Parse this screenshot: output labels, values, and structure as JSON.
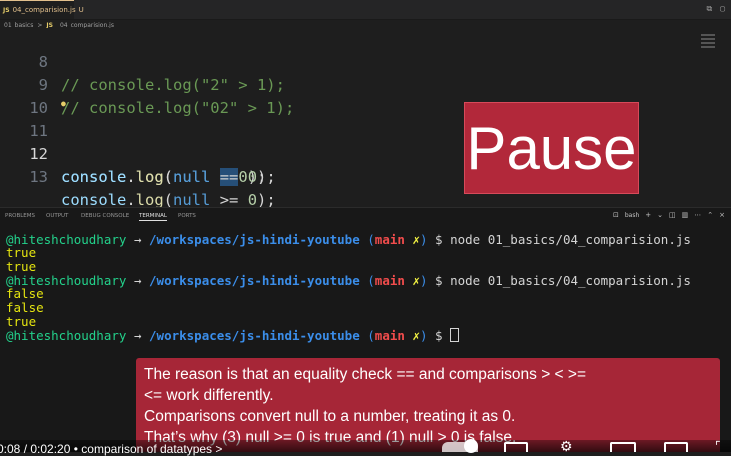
{
  "tab": {
    "name": "04_comparision.js",
    "badge": "JS",
    "modified": "U"
  },
  "breadcrumb": {
    "folder": "01_basics",
    "sep": ">",
    "file": "04_comparision.js"
  },
  "editor": {
    "lines": [
      {
        "num": "8",
        "text": "// console.log(\"2\" > 1);"
      },
      {
        "num": "9",
        "text": "// console.log(\"02\" > 1);"
      },
      {
        "num": "10",
        "text": ""
      },
      {
        "num": "11",
        "obj": "console",
        "fn": "log",
        "kw": "null",
        "op": ">",
        "val": "0"
      },
      {
        "num": "12",
        "obj": "console",
        "fn": "log",
        "kw": "null",
        "op": "==",
        "val": "0"
      },
      {
        "num": "13",
        "obj": "console",
        "fn": "log",
        "kw": "null",
        "op": ">=",
        "val": "0"
      }
    ]
  },
  "pause_overlay": "Pause",
  "panel": {
    "tabs": [
      "PROBLEMS",
      "OUTPUT",
      "DEBUG CONSOLE",
      "TERMINAL",
      "PORTS"
    ],
    "shell": "bash",
    "add": "+"
  },
  "terminal": {
    "user": "@hiteshchoudhary",
    "arrow": "→",
    "path": "/workspaces/js-hindi-youtube",
    "git_open": "(",
    "branch": "main",
    "dirty": "✗",
    "git_close": ")",
    "prompt": "$",
    "command": "node 01_basics/04_comparision.js",
    "outputs1": [
      "true",
      "true"
    ],
    "outputs2": [
      "false",
      "false",
      "true"
    ]
  },
  "caption": [
    "The reason is that an equality check == and comparisons > < >=",
    "<= work differently.",
    "Comparisons convert null to a number, treating it as 0.",
    "That’s why (3) null >= 0 is true and (1) null > 0 is false."
  ],
  "player": {
    "time": "0:08 / 0:02:20",
    "separator": "•",
    "chapter": "comparison of datatypes",
    "chevron": ">"
  }
}
